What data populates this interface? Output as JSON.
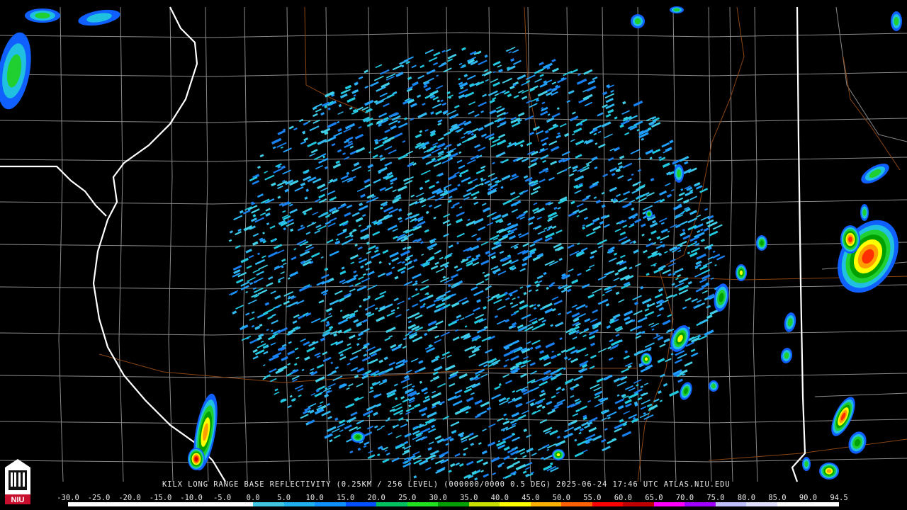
{
  "product": {
    "caption": "KILX LONG RANGE BASE REFLECTIVITY (0.25KM / 256 LEVEL) (000000/0000 0.5 DEG) 2025-06-24 17:46 UTC  ATLAS.NIU.EDU"
  },
  "logo": {
    "text": "NIU",
    "color": "#c8102e"
  },
  "color_scale": {
    "labels": [
      "-30.0",
      "-25.0",
      "-20.0",
      "-15.0",
      "-10.0",
      "-5.0",
      "0.0",
      "5.0",
      "10.0",
      "15.0",
      "20.0",
      "25.0",
      "30.0",
      "35.0",
      "40.0",
      "45.0",
      "50.0",
      "55.0",
      "60.0",
      "65.0",
      "70.0",
      "75.0",
      "80.0",
      "85.0",
      "90.0",
      "94.5"
    ],
    "colors": [
      "#ffffff",
      "#ffffff",
      "#ffffff",
      "#ffffff",
      "#ffffff",
      "#ffffff",
      "#40c8e0",
      "#20b0f0",
      "#1090ff",
      "#0050ff",
      "#00c060",
      "#20e020",
      "#00a000",
      "#c8e000",
      "#ffff00",
      "#ffb000",
      "#ff6000",
      "#ff0000",
      "#c00000",
      "#ff00ff",
      "#a000ff",
      "#c0c0ff",
      "#e0e0ff",
      "#ffffff",
      "#ffffff"
    ]
  }
}
